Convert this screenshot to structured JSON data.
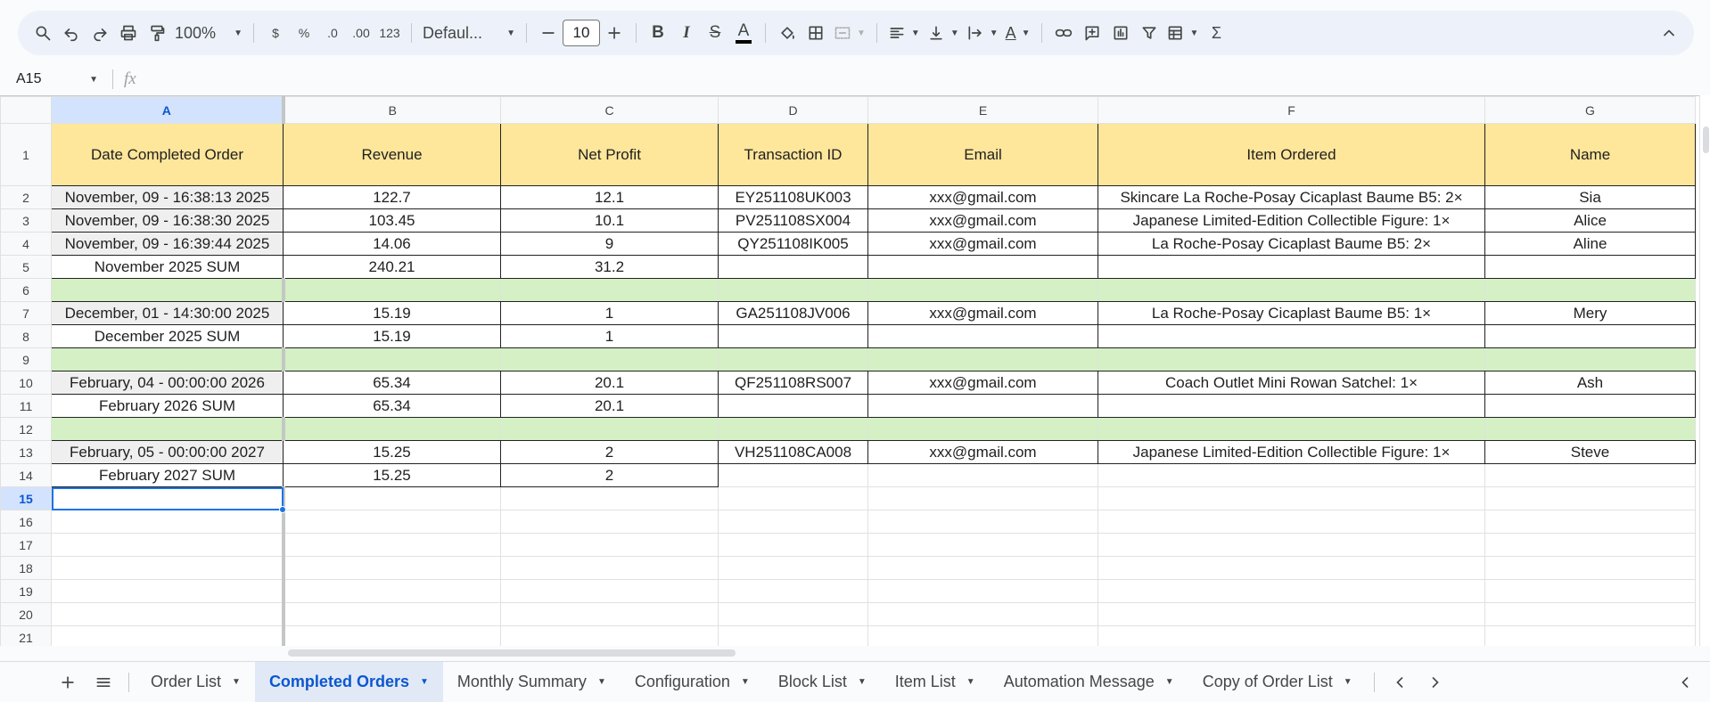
{
  "toolbar": {
    "zoom": "100%",
    "currency": "$",
    "percent": "%",
    "decrease_decimal": ".0",
    "increase_decimal": ".00",
    "number_format": "123",
    "font": "Defaul...",
    "font_size": "10",
    "bold": "B",
    "italic": "I",
    "strike": "S",
    "text_color": "A",
    "text_rotation": "A",
    "sum": "Σ"
  },
  "formula_bar": {
    "cell_ref": "A15",
    "fx": "fx"
  },
  "columns": [
    "A",
    "B",
    "C",
    "D",
    "E",
    "F",
    "G"
  ],
  "header_row": {
    "num": "1",
    "cells": [
      "Date Completed Order",
      "Revenue",
      "Net Profit",
      "Transaction ID",
      "Email",
      "Item Ordered",
      "Name"
    ]
  },
  "rows": [
    {
      "num": "2",
      "type": "data",
      "cells": [
        "November, 09 - 16:38:13 2025",
        "122.7",
        "12.1",
        "EY251108UK003",
        "xxx@gmail.com",
        "Skincare La Roche-Posay Cicaplast Baume B5: 2×",
        "Sia"
      ]
    },
    {
      "num": "3",
      "type": "data",
      "cells": [
        "November, 09 - 16:38:30 2025",
        "103.45",
        "10.1",
        "PV251108SX004",
        "xxx@gmail.com",
        "Japanese Limited-Edition Collectible Figure: 1×",
        "Alice"
      ]
    },
    {
      "num": "4",
      "type": "data",
      "cells": [
        "November, 09 - 16:39:44 2025",
        "14.06",
        "9",
        "QY251108IK005",
        "xxx@gmail.com",
        "La Roche-Posay Cicaplast Baume B5: 2×",
        "Aline"
      ]
    },
    {
      "num": "5",
      "type": "sum",
      "cells": [
        "November 2025 SUM",
        "240.21",
        "31.2",
        "",
        "",
        "",
        ""
      ]
    },
    {
      "num": "6",
      "type": "green",
      "cells": [
        "",
        "",
        "",
        "",
        "",
        "",
        ""
      ]
    },
    {
      "num": "7",
      "type": "data",
      "cells": [
        "December, 01 - 14:30:00 2025",
        "15.19",
        "1",
        "GA251108JV006",
        "xxx@gmail.com",
        "La Roche-Posay Cicaplast Baume B5: 1×",
        "Mery"
      ]
    },
    {
      "num": "8",
      "type": "sum",
      "cells": [
        "December 2025 SUM",
        "15.19",
        "1",
        "",
        "",
        "",
        ""
      ]
    },
    {
      "num": "9",
      "type": "green",
      "cells": [
        "",
        "",
        "",
        "",
        "",
        "",
        ""
      ]
    },
    {
      "num": "10",
      "type": "data",
      "cells": [
        "February, 04 - 00:00:00 2026",
        "65.34",
        "20.1",
        "QF251108RS007",
        "xxx@gmail.com",
        "Coach Outlet Mini Rowan Satchel: 1×",
        "Ash"
      ]
    },
    {
      "num": "11",
      "type": "sum",
      "cells": [
        "February 2026 SUM",
        "65.34",
        "20.1",
        "",
        "",
        "",
        ""
      ]
    },
    {
      "num": "12",
      "type": "green",
      "cells": [
        "",
        "",
        "",
        "",
        "",
        "",
        ""
      ]
    },
    {
      "num": "13",
      "type": "data",
      "cells": [
        "February, 05 - 00:00:00 2027",
        "15.25",
        "2",
        "VH251108CA008",
        "xxx@gmail.com",
        "Japanese Limited-Edition Collectible Figure: 1×",
        "Steve"
      ]
    },
    {
      "num": "14",
      "type": "sumlast",
      "cells": [
        "February 2027 SUM",
        "15.25",
        "2",
        "",
        "",
        "",
        ""
      ]
    },
    {
      "num": "15",
      "type": "empty",
      "cells": [
        "",
        "",
        "",
        "",
        "",
        "",
        ""
      ]
    },
    {
      "num": "16",
      "type": "empty",
      "cells": [
        "",
        "",
        "",
        "",
        "",
        "",
        ""
      ]
    },
    {
      "num": "17",
      "type": "empty",
      "cells": [
        "",
        "",
        "",
        "",
        "",
        "",
        ""
      ]
    },
    {
      "num": "18",
      "type": "empty",
      "cells": [
        "",
        "",
        "",
        "",
        "",
        "",
        ""
      ]
    },
    {
      "num": "19",
      "type": "empty",
      "cells": [
        "",
        "",
        "",
        "",
        "",
        "",
        ""
      ]
    },
    {
      "num": "20",
      "type": "empty",
      "cells": [
        "",
        "",
        "",
        "",
        "",
        "",
        ""
      ]
    },
    {
      "num": "21",
      "type": "empty",
      "cells": [
        "",
        "",
        "",
        "",
        "",
        "",
        ""
      ]
    }
  ],
  "active_row": "15",
  "sheet_tabs": [
    "Order List",
    "Completed Orders",
    "Monthly Summary",
    "Configuration",
    "Block List",
    "Item List",
    "Automation Message",
    "Copy of Order List"
  ],
  "active_tab": "Completed Orders",
  "colors": {
    "header_fill": "#fee69b",
    "separator_fill": "#d4f0c4",
    "accent": "#0b57d0",
    "selection": "#1a73e8"
  }
}
